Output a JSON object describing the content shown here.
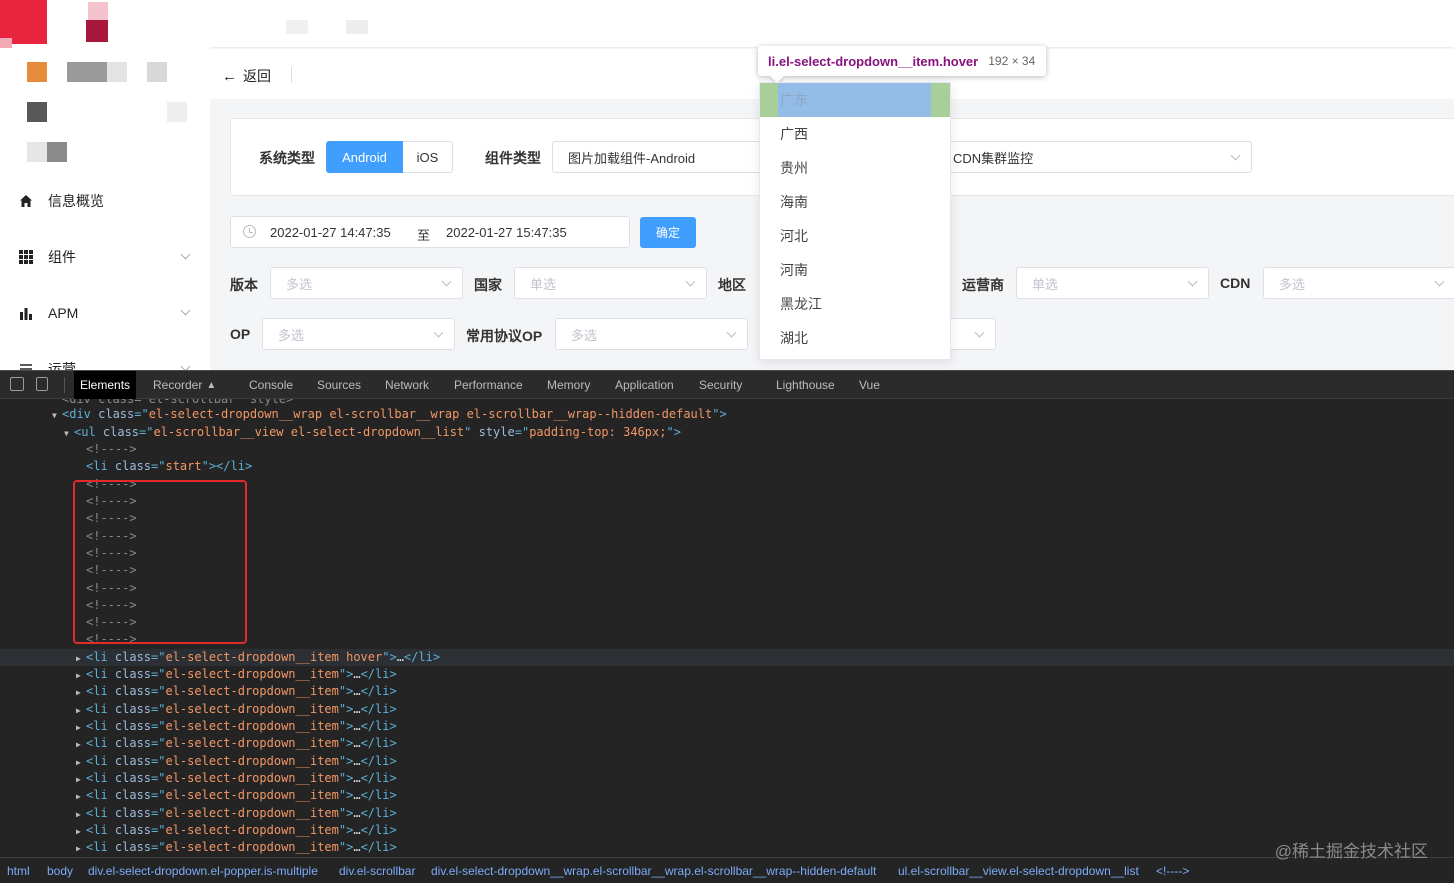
{
  "back_label": "返回",
  "sidebar": {
    "items": [
      {
        "label": "信息概览",
        "icon": "home-icon"
      },
      {
        "label": "组件",
        "icon": "grid-icon"
      },
      {
        "label": "APM",
        "icon": "bar-chart-icon"
      },
      {
        "label": "运营",
        "icon": "sliders-icon"
      }
    ]
  },
  "filters": {
    "system_type_label": "系统类型",
    "system_options": [
      "Android",
      "iOS"
    ],
    "component_type_label": "组件类型",
    "component_value": "图片加载组件-Android",
    "monitor_value": "CDN集群监控",
    "date_start": "2022-01-27 14:47:35",
    "date_sep": "至",
    "date_end": "2022-01-27 15:47:35",
    "confirm_label": "确定",
    "version_label": "版本",
    "version_placeholder": "多选",
    "country_label": "国家",
    "country_placeholder": "单选",
    "region_label": "地区",
    "carrier_label": "运营商",
    "carrier_placeholder": "单选",
    "cdn_label": "CDN",
    "cdn_placeholder": "多选",
    "op_label": "OP",
    "op_placeholder": "多选",
    "common_op_label": "常用协议OP",
    "common_op_placeholder": "多选"
  },
  "tooltip": {
    "selector": "li.el-select-dropdown__item.hover",
    "dims": "192 × 34"
  },
  "dropdown_options": [
    "广东",
    "广西",
    "贵州",
    "海南",
    "河北",
    "河南",
    "黑龙江",
    "湖北"
  ],
  "devtools": {
    "tabs": [
      "Elements",
      "Recorder",
      "Console",
      "Sources",
      "Network",
      "Performance",
      "Memory",
      "Application",
      "Security",
      "Lighthouse",
      "Vue"
    ],
    "recorder_icon": "flask-icon",
    "lines": [
      {
        "indent": 4,
        "tri": "",
        "parts": [
          [
            "cm",
            "<div class=\"el-scrollbar\" style>"
          ]
        ]
      },
      {
        "indent": 4,
        "tri": "▼",
        "parts": [
          [
            "tg",
            "<div "
          ],
          [
            "an",
            "class"
          ],
          [
            "tg",
            "=\""
          ],
          [
            "av",
            "el-select-dropdown__wrap el-scrollbar__wrap el-scrollbar__wrap--hidden-default"
          ],
          [
            "tg",
            "\">"
          ]
        ]
      },
      {
        "indent": 6,
        "tri": "▼",
        "parts": [
          [
            "tg",
            "<ul "
          ],
          [
            "an",
            "class"
          ],
          [
            "tg",
            "=\""
          ],
          [
            "av",
            "el-scrollbar__view el-select-dropdown__list"
          ],
          [
            "tg",
            "\" "
          ],
          [
            "an",
            "style"
          ],
          [
            "tg",
            "=\""
          ],
          [
            "av",
            "padding-top: 346px;"
          ],
          [
            "tg",
            "\">"
          ]
        ]
      },
      {
        "indent": 8,
        "tri": "",
        "parts": [
          [
            "cm",
            "<!---->"
          ]
        ]
      },
      {
        "indent": 8,
        "tri": "",
        "parts": [
          [
            "tg",
            "<li "
          ],
          [
            "an",
            "class"
          ],
          [
            "tg",
            "=\""
          ],
          [
            "av",
            "start"
          ],
          [
            "tg",
            "\"></li>"
          ]
        ]
      },
      {
        "indent": 8,
        "tri": "",
        "parts": [
          [
            "cm",
            "<!---->"
          ]
        ]
      },
      {
        "indent": 8,
        "tri": "",
        "parts": [
          [
            "cm",
            "<!---->"
          ]
        ]
      },
      {
        "indent": 8,
        "tri": "",
        "parts": [
          [
            "cm",
            "<!---->"
          ]
        ]
      },
      {
        "indent": 8,
        "tri": "",
        "parts": [
          [
            "cm",
            "<!---->"
          ]
        ]
      },
      {
        "indent": 8,
        "tri": "",
        "parts": [
          [
            "cm",
            "<!---->"
          ]
        ]
      },
      {
        "indent": 8,
        "tri": "",
        "parts": [
          [
            "cm",
            "<!---->"
          ]
        ]
      },
      {
        "indent": 8,
        "tri": "",
        "parts": [
          [
            "cm",
            "<!---->"
          ]
        ]
      },
      {
        "indent": 8,
        "tri": "",
        "parts": [
          [
            "cm",
            "<!---->"
          ]
        ]
      },
      {
        "indent": 8,
        "tri": "",
        "parts": [
          [
            "cm",
            "<!---->"
          ]
        ]
      },
      {
        "indent": 8,
        "tri": "",
        "parts": [
          [
            "cm",
            "<!---->"
          ]
        ]
      },
      {
        "indent": 8,
        "tri": "▶",
        "selected": true,
        "parts": [
          [
            "tg",
            "<li "
          ],
          [
            "an",
            "class"
          ],
          [
            "tg",
            "=\""
          ],
          [
            "av",
            "el-select-dropdown__item hover"
          ],
          [
            "tg",
            "\">"
          ],
          [
            "tx",
            "…"
          ],
          [
            "tg",
            "</li>"
          ]
        ]
      },
      {
        "indent": 8,
        "tri": "▶",
        "parts": [
          [
            "tg",
            "<li "
          ],
          [
            "an",
            "class"
          ],
          [
            "tg",
            "=\""
          ],
          [
            "av",
            "el-select-dropdown__item"
          ],
          [
            "tg",
            "\">"
          ],
          [
            "tx",
            "…"
          ],
          [
            "tg",
            "</li>"
          ]
        ]
      },
      {
        "indent": 8,
        "tri": "▶",
        "parts": [
          [
            "tg",
            "<li "
          ],
          [
            "an",
            "class"
          ],
          [
            "tg",
            "=\""
          ],
          [
            "av",
            "el-select-dropdown__item"
          ],
          [
            "tg",
            "\">"
          ],
          [
            "tx",
            "…"
          ],
          [
            "tg",
            "</li>"
          ]
        ]
      },
      {
        "indent": 8,
        "tri": "▶",
        "parts": [
          [
            "tg",
            "<li "
          ],
          [
            "an",
            "class"
          ],
          [
            "tg",
            "=\""
          ],
          [
            "av",
            "el-select-dropdown__item"
          ],
          [
            "tg",
            "\">"
          ],
          [
            "tx",
            "…"
          ],
          [
            "tg",
            "</li>"
          ]
        ]
      },
      {
        "indent": 8,
        "tri": "▶",
        "parts": [
          [
            "tg",
            "<li "
          ],
          [
            "an",
            "class"
          ],
          [
            "tg",
            "=\""
          ],
          [
            "av",
            "el-select-dropdown__item"
          ],
          [
            "tg",
            "\">"
          ],
          [
            "tx",
            "…"
          ],
          [
            "tg",
            "</li>"
          ]
        ]
      },
      {
        "indent": 8,
        "tri": "▶",
        "parts": [
          [
            "tg",
            "<li "
          ],
          [
            "an",
            "class"
          ],
          [
            "tg",
            "=\""
          ],
          [
            "av",
            "el-select-dropdown__item"
          ],
          [
            "tg",
            "\">"
          ],
          [
            "tx",
            "…"
          ],
          [
            "tg",
            "</li>"
          ]
        ]
      },
      {
        "indent": 8,
        "tri": "▶",
        "parts": [
          [
            "tg",
            "<li "
          ],
          [
            "an",
            "class"
          ],
          [
            "tg",
            "=\""
          ],
          [
            "av",
            "el-select-dropdown__item"
          ],
          [
            "tg",
            "\">"
          ],
          [
            "tx",
            "…"
          ],
          [
            "tg",
            "</li>"
          ]
        ]
      },
      {
        "indent": 8,
        "tri": "▶",
        "parts": [
          [
            "tg",
            "<li "
          ],
          [
            "an",
            "class"
          ],
          [
            "tg",
            "=\""
          ],
          [
            "av",
            "el-select-dropdown__item"
          ],
          [
            "tg",
            "\">"
          ],
          [
            "tx",
            "…"
          ],
          [
            "tg",
            "</li>"
          ]
        ]
      },
      {
        "indent": 8,
        "tri": "▶",
        "parts": [
          [
            "tg",
            "<li "
          ],
          [
            "an",
            "class"
          ],
          [
            "tg",
            "=\""
          ],
          [
            "av",
            "el-select-dropdown__item"
          ],
          [
            "tg",
            "\">"
          ],
          [
            "tx",
            "…"
          ],
          [
            "tg",
            "</li>"
          ]
        ]
      },
      {
        "indent": 8,
        "tri": "▶",
        "parts": [
          [
            "tg",
            "<li "
          ],
          [
            "an",
            "class"
          ],
          [
            "tg",
            "=\""
          ],
          [
            "av",
            "el-select-dropdown__item"
          ],
          [
            "tg",
            "\">"
          ],
          [
            "tx",
            "…"
          ],
          [
            "tg",
            "</li>"
          ]
        ]
      },
      {
        "indent": 8,
        "tri": "▶",
        "parts": [
          [
            "tg",
            "<li "
          ],
          [
            "an",
            "class"
          ],
          [
            "tg",
            "=\""
          ],
          [
            "av",
            "el-select-dropdown__item"
          ],
          [
            "tg",
            "\">"
          ],
          [
            "tx",
            "…"
          ],
          [
            "tg",
            "</li>"
          ]
        ]
      },
      {
        "indent": 8,
        "tri": "▶",
        "parts": [
          [
            "tg",
            "<li "
          ],
          [
            "an",
            "class"
          ],
          [
            "tg",
            "=\""
          ],
          [
            "av",
            "el-select-dropdown__item"
          ],
          [
            "tg",
            "\">"
          ],
          [
            "tx",
            "…"
          ],
          [
            "tg",
            "</li>"
          ]
        ]
      },
      {
        "indent": 8,
        "tri": "▶",
        "parts": [
          [
            "tg",
            "<li "
          ],
          [
            "an",
            "class"
          ],
          [
            "tg",
            "=\""
          ],
          [
            "av",
            "el-select-dropdown__item"
          ],
          [
            "tg",
            "\">"
          ],
          [
            "tx",
            "…"
          ],
          [
            "tg",
            "</li>"
          ]
        ]
      }
    ],
    "breadcrumbs": [
      "html",
      "body",
      "div.el-select-dropdown.el-popper.is-multiple",
      "div.el-scrollbar",
      "div.el-select-dropdown__wrap.el-scrollbar__wrap.el-scrollbar__wrap--hidden-default",
      "ul.el-scrollbar__view.el-select-dropdown__list",
      "<!---->"
    ]
  },
  "watermark": "@稀土掘金技术社区",
  "colors": {
    "primary": "#409eff",
    "highlight": "#e22c2c"
  }
}
